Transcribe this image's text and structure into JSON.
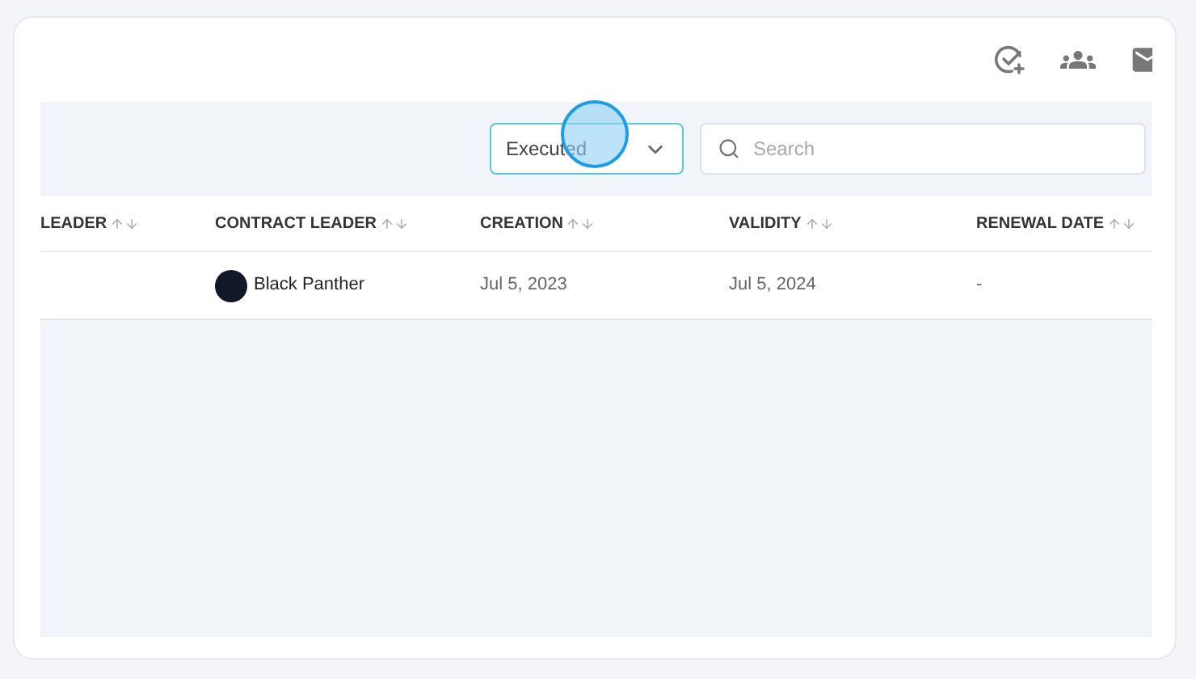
{
  "filter": {
    "status": "Executed",
    "search_placeholder": "Search"
  },
  "table": {
    "columns": [
      {
        "label": "LEADER"
      },
      {
        "label": "CONTRACT LEADER"
      },
      {
        "label": "CREATION"
      },
      {
        "label": "VALIDITY"
      },
      {
        "label": "RENEWAL DATE"
      }
    ],
    "rows": [
      {
        "column_1": "",
        "contract_leader": "Black Panther",
        "creation": "Jul 5, 2023",
        "validity": "Jul 5, 2024",
        "renewal_date": "-"
      }
    ]
  }
}
